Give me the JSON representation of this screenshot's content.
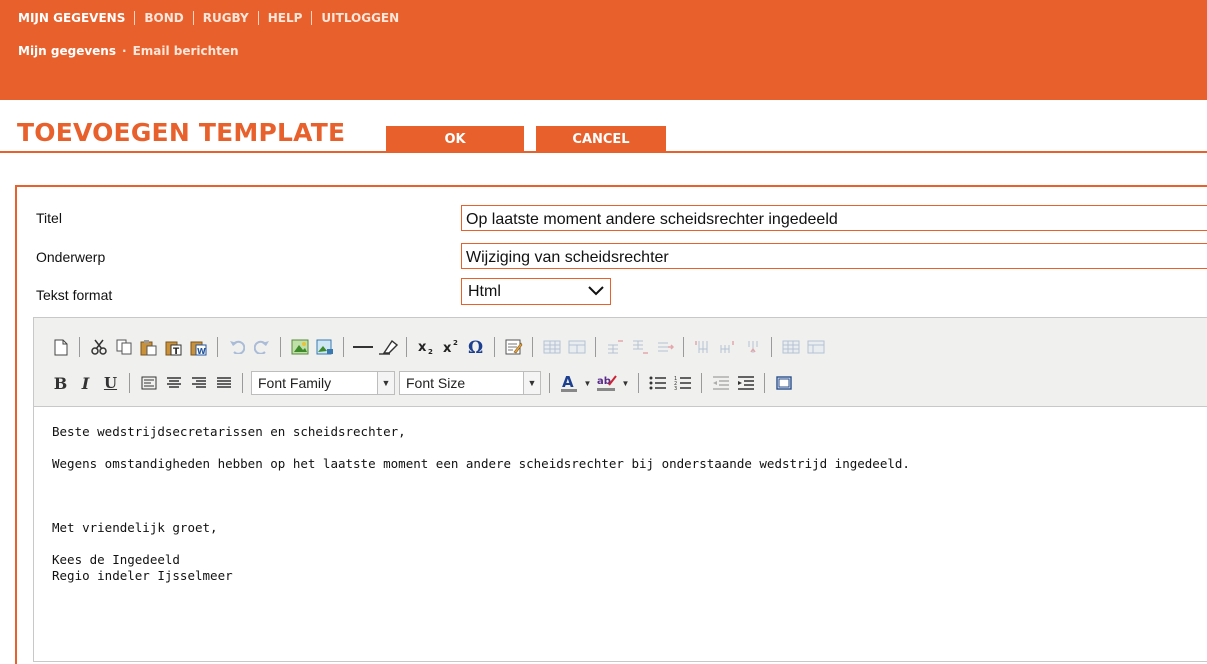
{
  "nav": {
    "main": [
      {
        "label": "MIJN GEGEVENS",
        "active": true
      },
      {
        "label": "BOND",
        "active": false
      },
      {
        "label": "RUGBY",
        "active": false
      },
      {
        "label": "HELP",
        "active": false
      },
      {
        "label": "UITLOGGEN",
        "active": false
      }
    ],
    "sub": {
      "active": "Mijn gegevens",
      "other": "Email berichten",
      "separator": "·"
    }
  },
  "page": {
    "title": "TOEVOEGEN TEMPLATE",
    "ok_label": "OK",
    "cancel_label": "CANCEL"
  },
  "form": {
    "titel": {
      "label": "Titel",
      "value": "Op laatste moment andere scheidsrechter ingedeeld"
    },
    "onderwerp": {
      "label": "Onderwerp",
      "value": "Wijziging van scheidsrechter"
    },
    "format": {
      "label": "Tekst format",
      "value": "Html",
      "arrow": "❯"
    }
  },
  "editor": {
    "font_family": "Font Family",
    "font_size": "Font Size",
    "lines": [
      "Beste wedstrijdsecretarissen en scheidsrechter,",
      "Wegens omstandigheden hebben op het laatste moment een andere scheidsrechter bij onderstaande wedstrijd ingedeeld.",
      "Met vriendelijk groet,",
      "Kees de Ingedeeld",
      "Regio indeler Ijsselmeer"
    ]
  },
  "colors": {
    "accent": "#e8612c",
    "toolbar_bg": "#f0f0ee"
  }
}
